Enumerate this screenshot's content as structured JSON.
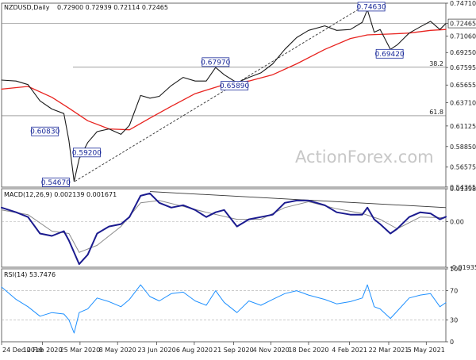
{
  "chart_data": [
    {
      "type": "line",
      "pane": "price",
      "title": "NZDUSD,Daily",
      "ohlc_text": "0.72900 0.72939 0.72114 0.72465",
      "watermark": "ActionForex.com",
      "x_tick_labels": [
        "24 Dec 2019",
        "10 Feb 2020",
        "25 Mar 2020",
        "8 May 2020",
        "23 Jun 2020",
        "6 Aug 2020",
        "21 Sep 2020",
        "4 Nov 2020",
        "18 Dec 2020",
        "4 Feb 2021",
        "22 Mar 2021",
        "5 May 2021"
      ],
      "y_tick_labels": [
        "0.74710",
        "0.72465",
        "0.71060",
        "0.69250",
        "0.67595",
        "0.65655",
        "0.63710",
        "0.61125",
        "0.58850",
        "0.56575",
        "0.54365"
      ],
      "ylim": [
        0.5436,
        0.7471
      ],
      "last_price": 0.72465,
      "last_price_label": "0.72465",
      "annotations": [
        {
          "text": "0.54670",
          "x": "2020-03-18",
          "y": 0.5467
        },
        {
          "text": "0.60830",
          "x": "2020-02-25",
          "y": 0.6083
        },
        {
          "text": "0.59200",
          "x": "2020-04-14",
          "y": 0.592
        },
        {
          "text": "0.67970",
          "x": "2020-08-31",
          "y": 0.6797
        },
        {
          "text": "0.65890",
          "x": "2020-09-25",
          "y": 0.6589
        },
        {
          "text": "0.74630",
          "x": "2021-02-25",
          "y": 0.7463
        },
        {
          "text": "0.69420",
          "x": "2021-03-24",
          "y": 0.6942
        }
      ],
      "fib_levels": [
        {
          "label": "38.2",
          "y": 0.6762
        },
        {
          "label": "61.8",
          "y": 0.6226
        }
      ],
      "trendlines": [
        {
          "from": {
            "x": "2020-03-19",
            "y": 0.55
          },
          "to": {
            "x": "2021-02-25",
            "y": 0.7463
          }
        }
      ],
      "series": [
        {
          "name": "Close",
          "color": "#1a1a1a",
          "points": [
            {
              "x": "2019-12-24",
              "y": 0.662
            },
            {
              "x": "2020-01-10",
              "y": 0.661
            },
            {
              "x": "2020-01-24",
              "y": 0.657
            },
            {
              "x": "2020-02-07",
              "y": 0.639
            },
            {
              "x": "2020-02-21",
              "y": 0.63
            },
            {
              "x": "2020-03-06",
              "y": 0.625
            },
            {
              "x": "2020-03-12",
              "y": 0.595
            },
            {
              "x": "2020-03-18",
              "y": 0.55
            },
            {
              "x": "2020-03-24",
              "y": 0.575
            },
            {
              "x": "2020-04-03",
              "y": 0.593
            },
            {
              "x": "2020-04-14",
              "y": 0.605
            },
            {
              "x": "2020-04-28",
              "y": 0.608
            },
            {
              "x": "2020-05-12",
              "y": 0.602
            },
            {
              "x": "2020-05-22",
              "y": 0.612
            },
            {
              "x": "2020-06-04",
              "y": 0.645
            },
            {
              "x": "2020-06-15",
              "y": 0.642
            },
            {
              "x": "2020-06-26",
              "y": 0.644
            },
            {
              "x": "2020-07-10",
              "y": 0.656
            },
            {
              "x": "2020-07-24",
              "y": 0.665
            },
            {
              "x": "2020-08-07",
              "y": 0.661
            },
            {
              "x": "2020-08-20",
              "y": 0.661
            },
            {
              "x": "2020-08-31",
              "y": 0.676
            },
            {
              "x": "2020-09-10",
              "y": 0.668
            },
            {
              "x": "2020-09-25",
              "y": 0.659
            },
            {
              "x": "2020-10-09",
              "y": 0.665
            },
            {
              "x": "2020-10-23",
              "y": 0.67
            },
            {
              "x": "2020-11-06",
              "y": 0.68
            },
            {
              "x": "2020-11-20",
              "y": 0.696
            },
            {
              "x": "2020-12-04",
              "y": 0.709
            },
            {
              "x": "2020-12-18",
              "y": 0.717
            },
            {
              "x": "2021-01-06",
              "y": 0.722
            },
            {
              "x": "2021-01-20",
              "y": 0.717
            },
            {
              "x": "2021-02-05",
              "y": 0.718
            },
            {
              "x": "2021-02-19",
              "y": 0.726
            },
            {
              "x": "2021-02-25",
              "y": 0.74
            },
            {
              "x": "2021-03-05",
              "y": 0.715
            },
            {
              "x": "2021-03-12",
              "y": 0.718
            },
            {
              "x": "2021-03-24",
              "y": 0.696
            },
            {
              "x": "2021-04-01",
              "y": 0.701
            },
            {
              "x": "2021-04-15",
              "y": 0.714
            },
            {
              "x": "2021-04-28",
              "y": 0.721
            },
            {
              "x": "2021-05-10",
              "y": 0.727
            },
            {
              "x": "2021-05-21",
              "y": 0.718
            },
            {
              "x": "2021-05-28",
              "y": 0.7246
            }
          ]
        },
        {
          "name": "Moving average",
          "color": "#e8231f",
          "points": [
            {
              "x": "2019-12-24",
              "y": 0.652
            },
            {
              "x": "2020-01-24",
              "y": 0.655
            },
            {
              "x": "2020-02-21",
              "y": 0.643
            },
            {
              "x": "2020-03-12",
              "y": 0.631
            },
            {
              "x": "2020-04-03",
              "y": 0.617
            },
            {
              "x": "2020-04-28",
              "y": 0.608
            },
            {
              "x": "2020-05-22",
              "y": 0.607
            },
            {
              "x": "2020-06-15",
              "y": 0.62
            },
            {
              "x": "2020-07-10",
              "y": 0.633
            },
            {
              "x": "2020-08-07",
              "y": 0.647
            },
            {
              "x": "2020-09-10",
              "y": 0.657
            },
            {
              "x": "2020-10-09",
              "y": 0.661
            },
            {
              "x": "2020-11-06",
              "y": 0.668
            },
            {
              "x": "2020-12-04",
              "y": 0.68
            },
            {
              "x": "2021-01-06",
              "y": 0.696
            },
            {
              "x": "2021-02-05",
              "y": 0.708
            },
            {
              "x": "2021-02-25",
              "y": 0.712
            },
            {
              "x": "2021-03-24",
              "y": 0.713
            },
            {
              "x": "2021-04-15",
              "y": 0.714
            },
            {
              "x": "2021-05-10",
              "y": 0.717
            },
            {
              "x": "2021-05-28",
              "y": 0.718
            }
          ]
        }
      ]
    },
    {
      "type": "line",
      "pane": "macd",
      "title": "MACD(12,26,9) 0.002139 0.001671",
      "y_tick_labels": [
        "0.01398",
        "0.00",
        "-0.019352"
      ],
      "ylim": [
        -0.0193,
        0.014
      ],
      "zero_line": 0,
      "trendlines": [
        {
          "from": {
            "x": "2020-06-15",
            "y": 0.0128
          },
          "to": {
            "x": "2021-05-28",
            "y": 0.006
          }
        }
      ],
      "series": [
        {
          "name": "MACD",
          "color": "#1b1b8f",
          "points": [
            {
              "x": "2019-12-24",
              "y": 0.006
            },
            {
              "x": "2020-01-10",
              "y": 0.004
            },
            {
              "x": "2020-01-24",
              "y": 0.002
            },
            {
              "x": "2020-02-07",
              "y": -0.005
            },
            {
              "x": "2020-02-21",
              "y": -0.006
            },
            {
              "x": "2020-03-06",
              "y": -0.004
            },
            {
              "x": "2020-03-12",
              "y": -0.008
            },
            {
              "x": "2020-03-24",
              "y": -0.018
            },
            {
              "x": "2020-04-03",
              "y": -0.014
            },
            {
              "x": "2020-04-14",
              "y": -0.005
            },
            {
              "x": "2020-04-28",
              "y": -0.002
            },
            {
              "x": "2020-05-12",
              "y": -0.001
            },
            {
              "x": "2020-05-22",
              "y": 0.002
            },
            {
              "x": "2020-06-04",
              "y": 0.011
            },
            {
              "x": "2020-06-15",
              "y": 0.012
            },
            {
              "x": "2020-06-26",
              "y": 0.008
            },
            {
              "x": "2020-07-10",
              "y": 0.006
            },
            {
              "x": "2020-07-24",
              "y": 0.007
            },
            {
              "x": "2020-08-07",
              "y": 0.005
            },
            {
              "x": "2020-08-20",
              "y": 0.002
            },
            {
              "x": "2020-08-31",
              "y": 0.004
            },
            {
              "x": "2020-09-10",
              "y": 0.005
            },
            {
              "x": "2020-09-25",
              "y": -0.002
            },
            {
              "x": "2020-10-09",
              "y": 0.001
            },
            {
              "x": "2020-10-23",
              "y": 0.002
            },
            {
              "x": "2020-11-06",
              "y": 0.003
            },
            {
              "x": "2020-11-20",
              "y": 0.008
            },
            {
              "x": "2020-12-04",
              "y": 0.009
            },
            {
              "x": "2020-12-18",
              "y": 0.009
            },
            {
              "x": "2021-01-06",
              "y": 0.007
            },
            {
              "x": "2021-01-20",
              "y": 0.004
            },
            {
              "x": "2021-02-05",
              "y": 0.003
            },
            {
              "x": "2021-02-19",
              "y": 0.003
            },
            {
              "x": "2021-02-25",
              "y": 0.006
            },
            {
              "x": "2021-03-05",
              "y": 0.001
            },
            {
              "x": "2021-03-12",
              "y": -0.001
            },
            {
              "x": "2021-03-24",
              "y": -0.005
            },
            {
              "x": "2021-04-01",
              "y": -0.003
            },
            {
              "x": "2021-04-15",
              "y": 0.002
            },
            {
              "x": "2021-04-28",
              "y": 0.004
            },
            {
              "x": "2021-05-10",
              "y": 0.0035
            },
            {
              "x": "2021-05-21",
              "y": 0.001
            },
            {
              "x": "2021-05-28",
              "y": 0.0021
            }
          ]
        },
        {
          "name": "Signal",
          "color": "#8a8a8a",
          "points": [
            {
              "x": "2019-12-24",
              "y": 0.005
            },
            {
              "x": "2020-01-24",
              "y": 0.003
            },
            {
              "x": "2020-02-21",
              "y": -0.004
            },
            {
              "x": "2020-03-12",
              "y": -0.005
            },
            {
              "x": "2020-03-24",
              "y": -0.013
            },
            {
              "x": "2020-04-14",
              "y": -0.01
            },
            {
              "x": "2020-05-12",
              "y": -0.002
            },
            {
              "x": "2020-06-04",
              "y": 0.008
            },
            {
              "x": "2020-06-26",
              "y": 0.009
            },
            {
              "x": "2020-07-24",
              "y": 0.0065
            },
            {
              "x": "2020-08-20",
              "y": 0.004
            },
            {
              "x": "2020-09-25",
              "y": 0.001
            },
            {
              "x": "2020-10-23",
              "y": 0.001
            },
            {
              "x": "2020-11-20",
              "y": 0.006
            },
            {
              "x": "2020-12-18",
              "y": 0.0085
            },
            {
              "x": "2021-01-20",
              "y": 0.0055
            },
            {
              "x": "2021-02-19",
              "y": 0.0035
            },
            {
              "x": "2021-03-12",
              "y": 0.001
            },
            {
              "x": "2021-04-01",
              "y": -0.003
            },
            {
              "x": "2021-04-28",
              "y": 0.002
            },
            {
              "x": "2021-05-28",
              "y": 0.0017
            }
          ]
        }
      ]
    },
    {
      "type": "line",
      "pane": "rsi",
      "title": "RSI(14) 53.7476",
      "y_tick_labels": [
        "100",
        "70",
        "30",
        "0"
      ],
      "ylim": [
        0,
        100
      ],
      "levels": [
        70,
        30
      ],
      "series": [
        {
          "name": "RSI",
          "color": "#1e90ff",
          "points": [
            {
              "x": "2019-12-24",
              "y": 75
            },
            {
              "x": "2020-01-10",
              "y": 58
            },
            {
              "x": "2020-01-24",
              "y": 48
            },
            {
              "x": "2020-02-07",
              "y": 35
            },
            {
              "x": "2020-02-21",
              "y": 40
            },
            {
              "x": "2020-03-06",
              "y": 38
            },
            {
              "x": "2020-03-12",
              "y": 30
            },
            {
              "x": "2020-03-18",
              "y": 12
            },
            {
              "x": "2020-03-24",
              "y": 40
            },
            {
              "x": "2020-04-03",
              "y": 45
            },
            {
              "x": "2020-04-14",
              "y": 60
            },
            {
              "x": "2020-04-28",
              "y": 55
            },
            {
              "x": "2020-05-12",
              "y": 48
            },
            {
              "x": "2020-05-22",
              "y": 58
            },
            {
              "x": "2020-06-04",
              "y": 78
            },
            {
              "x": "2020-06-15",
              "y": 62
            },
            {
              "x": "2020-06-26",
              "y": 56
            },
            {
              "x": "2020-07-10",
              "y": 66
            },
            {
              "x": "2020-07-24",
              "y": 68
            },
            {
              "x": "2020-08-07",
              "y": 56
            },
            {
              "x": "2020-08-20",
              "y": 50
            },
            {
              "x": "2020-08-31",
              "y": 70
            },
            {
              "x": "2020-09-10",
              "y": 54
            },
            {
              "x": "2020-09-25",
              "y": 40
            },
            {
              "x": "2020-10-09",
              "y": 56
            },
            {
              "x": "2020-10-23",
              "y": 50
            },
            {
              "x": "2020-11-06",
              "y": 58
            },
            {
              "x": "2020-11-20",
              "y": 66
            },
            {
              "x": "2020-12-04",
              "y": 70
            },
            {
              "x": "2020-12-18",
              "y": 64
            },
            {
              "x": "2021-01-06",
              "y": 58
            },
            {
              "x": "2021-01-20",
              "y": 52
            },
            {
              "x": "2021-02-05",
              "y": 55
            },
            {
              "x": "2021-02-19",
              "y": 60
            },
            {
              "x": "2021-02-25",
              "y": 78
            },
            {
              "x": "2021-03-05",
              "y": 48
            },
            {
              "x": "2021-03-12",
              "y": 45
            },
            {
              "x": "2021-03-24",
              "y": 32
            },
            {
              "x": "2021-04-01",
              "y": 42
            },
            {
              "x": "2021-04-15",
              "y": 60
            },
            {
              "x": "2021-04-28",
              "y": 64
            },
            {
              "x": "2021-05-10",
              "y": 66
            },
            {
              "x": "2021-05-21",
              "y": 48
            },
            {
              "x": "2021-05-28",
              "y": 53.75
            }
          ]
        }
      ]
    }
  ]
}
